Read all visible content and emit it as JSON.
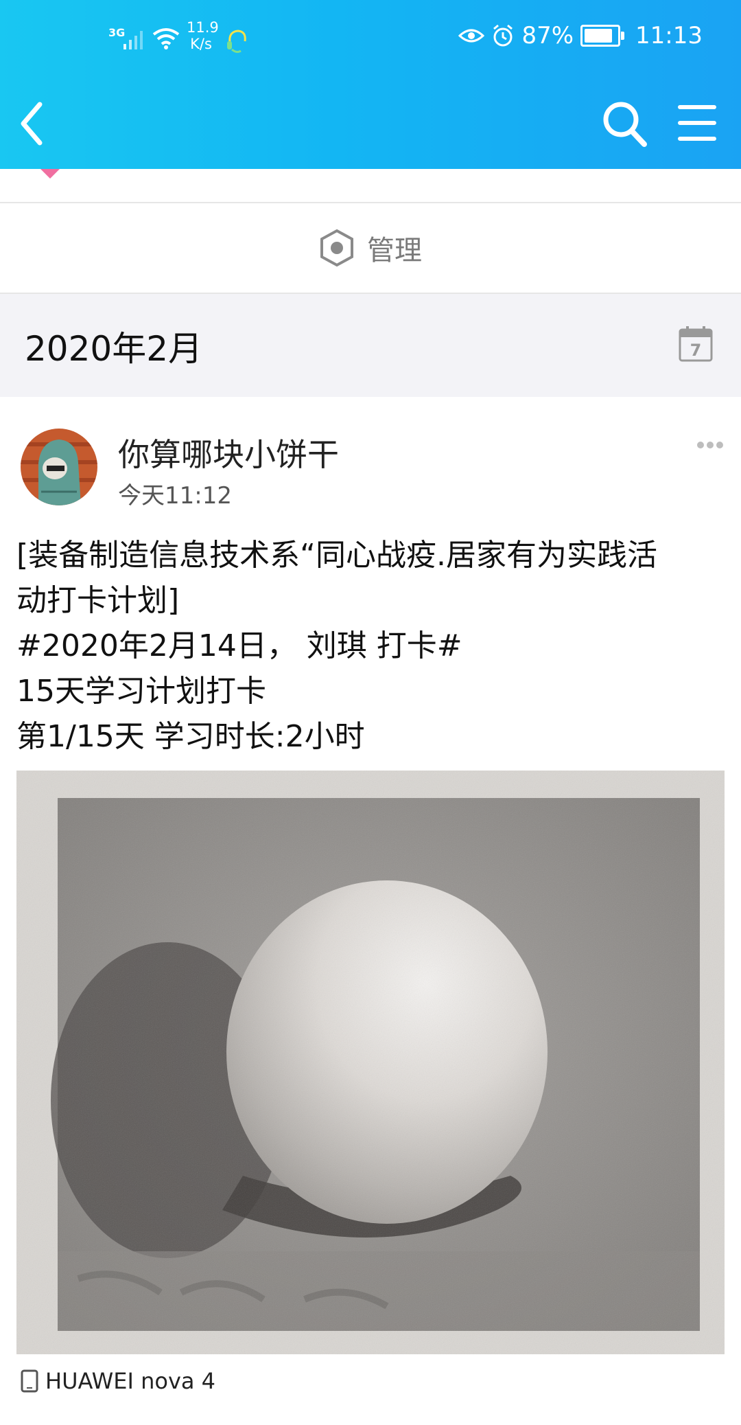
{
  "status_bar": {
    "network": "3G",
    "speed": "11.9\nK/s",
    "battery": "87%",
    "battery_level": 0.87,
    "time": "11:13"
  },
  "icons": {
    "back": "chevron-left-icon",
    "search": "search-icon",
    "menu": "hamburger-menu-icon",
    "manage": "hexagon-settings-icon",
    "calendar": "calendar-icon",
    "more": "more-dots-icon",
    "device": "phone-icon"
  },
  "colors": {
    "accent": "#13b6f3"
  },
  "manage": {
    "label": "管理"
  },
  "month": {
    "label": "2020年2月"
  },
  "post": {
    "username": "你算哪块小饼干",
    "time": "今天11:12",
    "lines": [
      "[装备制造信息技术系“同心战疫.居家有为实践活",
      "动打卡计划]",
      "#2020年2月14日，      刘琪 打卡#",
      "15天学习计划打卡",
      "第1/15天 学习时长:2小时"
    ],
    "device": "HUAWEI nova 4"
  }
}
